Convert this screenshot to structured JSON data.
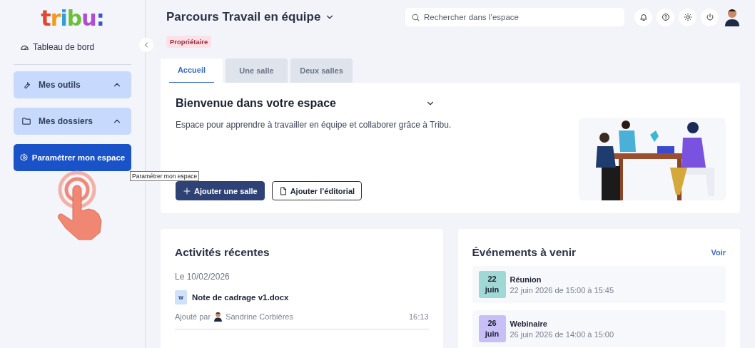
{
  "logo": "tribu:",
  "sidebar": {
    "dashboard": "Tableau de bord",
    "groups": [
      {
        "label": "Mes outils",
        "expanded": true
      },
      {
        "label": "Mes dossiers",
        "expanded": true
      }
    ],
    "settings_button": "Paramétrer mon espace",
    "tooltip": "Paramétrer mon espace"
  },
  "header": {
    "title": "Parcours Travail en équipe",
    "role": "Propriétaire",
    "search": {
      "placeholder": "Rechercher dans l’espace"
    }
  },
  "tabs": [
    {
      "label": "Accueil",
      "selected": true
    },
    {
      "label": "Une salle",
      "selected": false
    },
    {
      "label": "Deux salles",
      "selected": false
    }
  ],
  "welcome": {
    "title": "Bienvenue dans votre espace",
    "description": "Espace pour apprendre à travailler en équipe et collaborer grâce à Tribu.",
    "buttons": [
      {
        "label": "Ajouter une salle",
        "kind": "primary"
      },
      {
        "label": "Ajouter l’éditorial",
        "kind": "outline"
      }
    ]
  },
  "activities": {
    "title": "Activités récentes",
    "date": "Le 10/02/2026",
    "items": [
      {
        "file_type": "W",
        "name": "Note de cadrage v1.docx",
        "added_by": "Ajouté par",
        "author": "Sandrine Corbières",
        "time": "16:13"
      }
    ]
  },
  "events": {
    "title": "Événements à venir",
    "link": "Voir",
    "items": [
      {
        "day": "22",
        "month": "juin",
        "title": "Réunion",
        "when": "22 juin 2026 de 15:00 à 15:45",
        "color": "#9fd8d4"
      },
      {
        "day": "26",
        "month": "juin",
        "title": "Webinaire",
        "when": "26 juin 2026 de 14:00 à 15:00",
        "color": "#c8bff7"
      }
    ]
  }
}
